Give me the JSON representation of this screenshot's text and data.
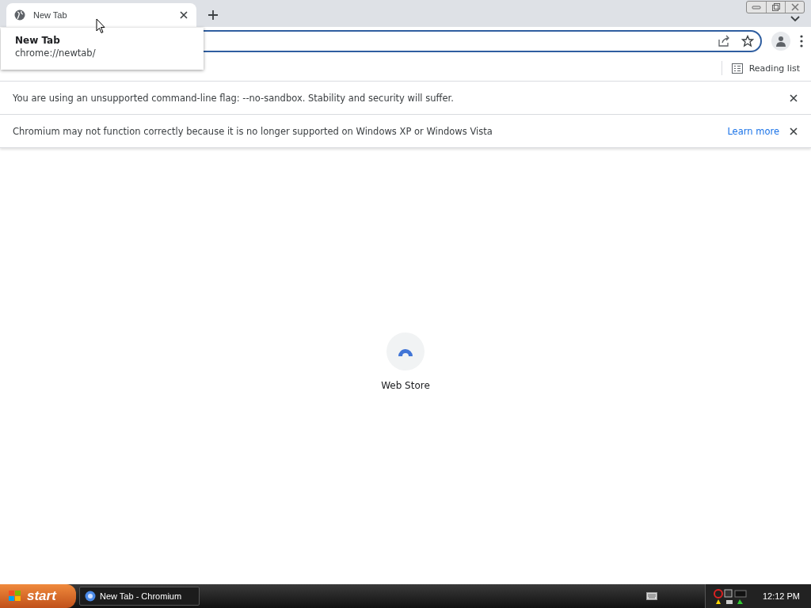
{
  "tabs": [
    {
      "title": "New Tab",
      "selected": true
    }
  ],
  "tab_tooltip": {
    "title": "New Tab",
    "url": "chrome://newtab/"
  },
  "bookmarks_bar": {
    "reading_list": "Reading list"
  },
  "infobars": [
    {
      "message": "You are using an unsupported command-line flag: --no-sandbox. Stability and security will suffer."
    },
    {
      "message": "Chromium may not function correctly because it is no longer supported on Windows XP or Windows Vista",
      "link": "Learn more"
    }
  ],
  "shortcuts": [
    {
      "label": "Web Store"
    }
  ],
  "taskbar": {
    "start": "start",
    "tasks": [
      {
        "label": "New Tab - Chromium",
        "selected": false
      }
    ],
    "clock": "12:12 PM"
  }
}
